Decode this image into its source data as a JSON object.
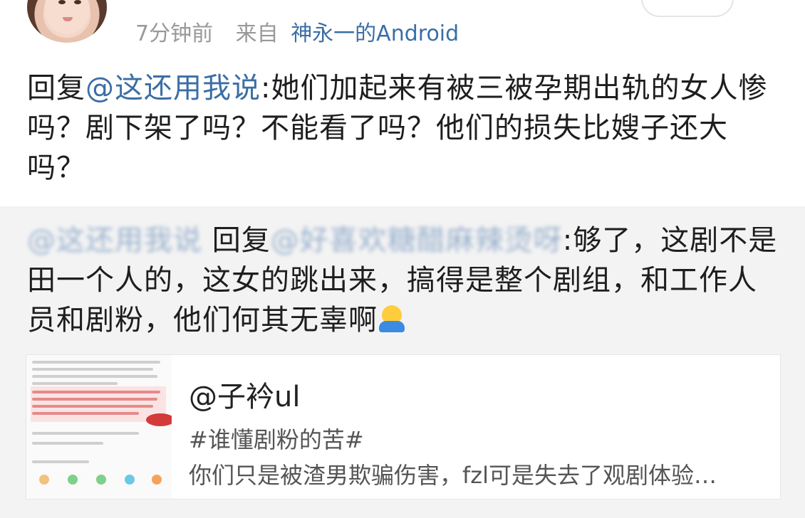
{
  "post": {
    "time": "7分钟前",
    "from_label": "来自",
    "device": "神永一的Android"
  },
  "reply": {
    "prefix": "回复",
    "mention": "@这还用我说",
    "text": ":她们加起来有被三被孕期出轨的女人惨吗？剧下架了吗？不能看了吗？他们的损失比嫂子还大吗？"
  },
  "quoted": {
    "author_mention": "@这还用我说",
    "reply_label": "回复",
    "target_mention": "@好喜欢糖醋麻辣烫呀",
    "text": ":够了，这剧不是田一个人的，这女的跳出来，搞得是整个剧组，和工作人员和剧粉，他们何其无辜啊"
  },
  "card": {
    "title": "@子衿ul",
    "tag": "#谁懂剧粉的苦#",
    "desc": "你们只是被渣男欺骗伤害，fzl可是失去了观剧体验…"
  },
  "colors": {
    "link": "#3b6ea5",
    "quote_bg": "#f3f3f3"
  },
  "icons": [
    "avatar",
    "hug-emoji-icon",
    "card-thumbnail"
  ]
}
